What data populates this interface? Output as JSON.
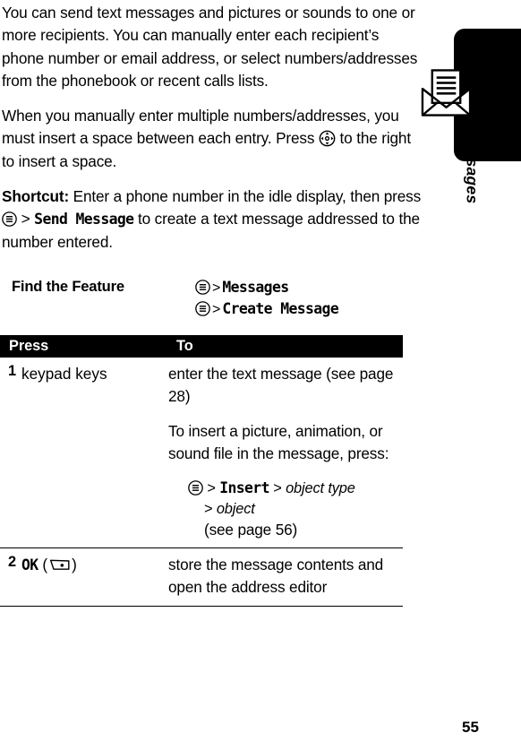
{
  "page": {
    "number": "55",
    "chapter_tab": {
      "label": "Messages",
      "icon": "envelope-letter-icon",
      "tab_color": "#000000"
    }
  },
  "body": {
    "paragraphs": [
      "You can send text messages and pictures or sounds to one or more recipients. You can manually enter each recipient’s phone number or email address, or select numbers/addresses from the phonebook or recent calls lists."
    ],
    "paragraph2": {
      "before_icon": "When you manually enter multiple numbers/addresses, you must insert a space between each entry. Press ",
      "icon": "nav-key-icon",
      "after_icon": " to the right to insert a space."
    },
    "shortcut": {
      "label": "Shortcut:",
      "text_before_key": " Enter a phone number in the idle display, then press ",
      "key_icon": "menu-key-icon",
      "separator": ">",
      "menu_item": "Send Message",
      "text_after": " to create a text message addressed to the number entered."
    }
  },
  "find_the_feature": {
    "heading": "Find the Feature",
    "lines": [
      {
        "icon": "menu-key-icon",
        "separator": ">",
        "item": "Messages"
      },
      {
        "icon": "menu-key-icon",
        "separator": ">",
        "item": "Create Message"
      }
    ]
  },
  "steps_table": {
    "headers": {
      "press": "Press",
      "to": "To"
    },
    "rows": [
      {
        "num": "1",
        "press": "keypad keys",
        "to_paragraphs": [
          "enter the text message (see page 28)",
          "To insert a picture, animation, or sound file in the message, press:"
        ],
        "insert_path": {
          "icon": "menu-key-icon",
          "sep1": ">",
          "command": "Insert",
          "sep2": ">",
          "arg1": "object type",
          "sep3": ">",
          "arg2": "object",
          "reference": "(see page 56)"
        }
      },
      {
        "num": "2",
        "press_label": "OK",
        "press_key_icon": "soft-key-icon",
        "press_paren_open": "(",
        "press_paren_close": ")",
        "to_paragraphs": [
          "store the message contents and open the address editor"
        ]
      }
    ]
  }
}
